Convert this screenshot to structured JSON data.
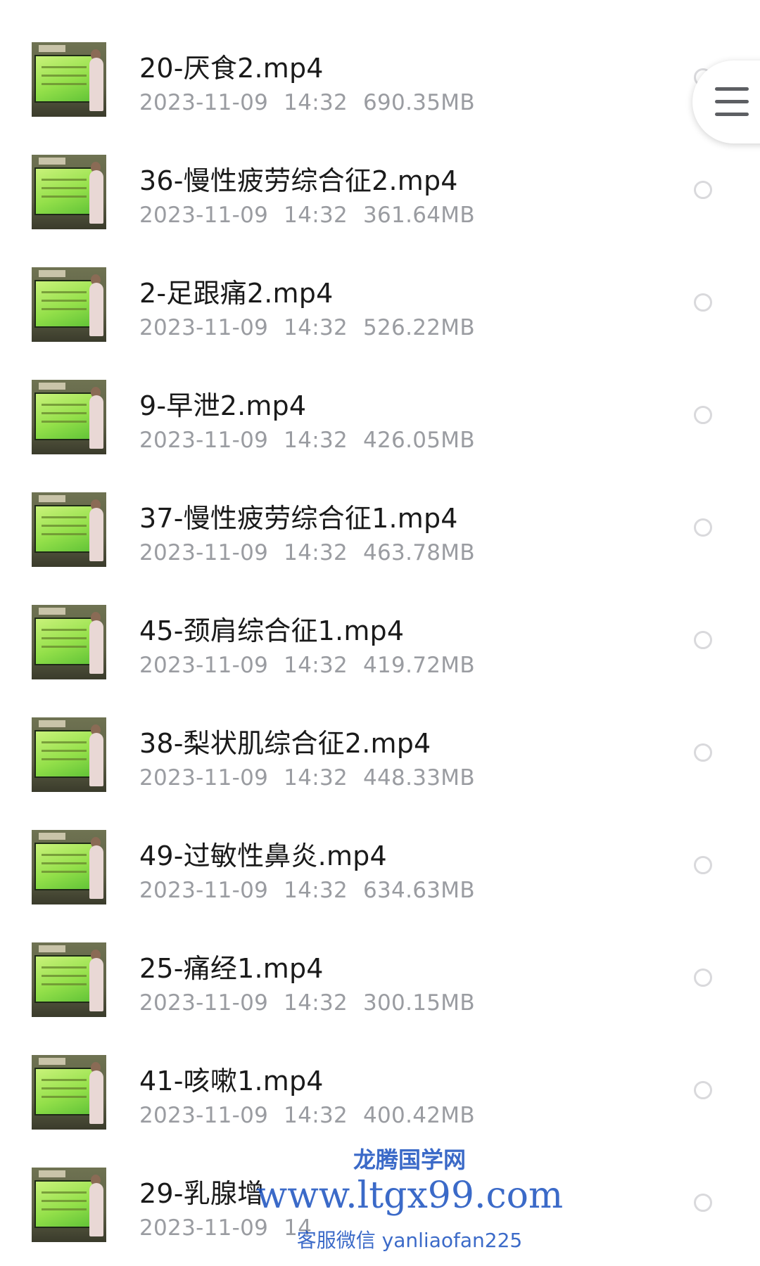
{
  "files": [
    {
      "name": "20-厌食2.mp4",
      "date": "2023-11-09",
      "time": "14:32",
      "size": "690.35MB"
    },
    {
      "name": "36-慢性疲劳综合征2.mp4",
      "date": "2023-11-09",
      "time": "14:32",
      "size": "361.64MB"
    },
    {
      "name": "2-足跟痛2.mp4",
      "date": "2023-11-09",
      "time": "14:32",
      "size": "526.22MB"
    },
    {
      "name": "9-早泄2.mp4",
      "date": "2023-11-09",
      "time": "14:32",
      "size": "426.05MB"
    },
    {
      "name": "37-慢性疲劳综合征1.mp4",
      "date": "2023-11-09",
      "time": "14:32",
      "size": "463.78MB"
    },
    {
      "name": "45-颈肩综合征1.mp4",
      "date": "2023-11-09",
      "time": "14:32",
      "size": "419.72MB"
    },
    {
      "name": "38-梨状肌综合征2.mp4",
      "date": "2023-11-09",
      "time": "14:32",
      "size": "448.33MB"
    },
    {
      "name": "49-过敏性鼻炎.mp4",
      "date": "2023-11-09",
      "time": "14:32",
      "size": "634.63MB"
    },
    {
      "name": "25-痛经1.mp4",
      "date": "2023-11-09",
      "time": "14:32",
      "size": "300.15MB"
    },
    {
      "name": "41-咳嗽1.mp4",
      "date": "2023-11-09",
      "time": "14:32",
      "size": "400.42MB"
    },
    {
      "name": "29-乳腺增",
      "date": "2023-11-09",
      "time": "14",
      "size": ""
    }
  ],
  "watermark": {
    "line1": "龙腾国学网",
    "line2": "www.ltgx99.com",
    "line3": "客服微信 yanliaofan225"
  },
  "icons": {
    "menu": "hamburger-menu-icon",
    "select": "radio-circle-icon",
    "thumbnail": "video-thumbnail"
  }
}
